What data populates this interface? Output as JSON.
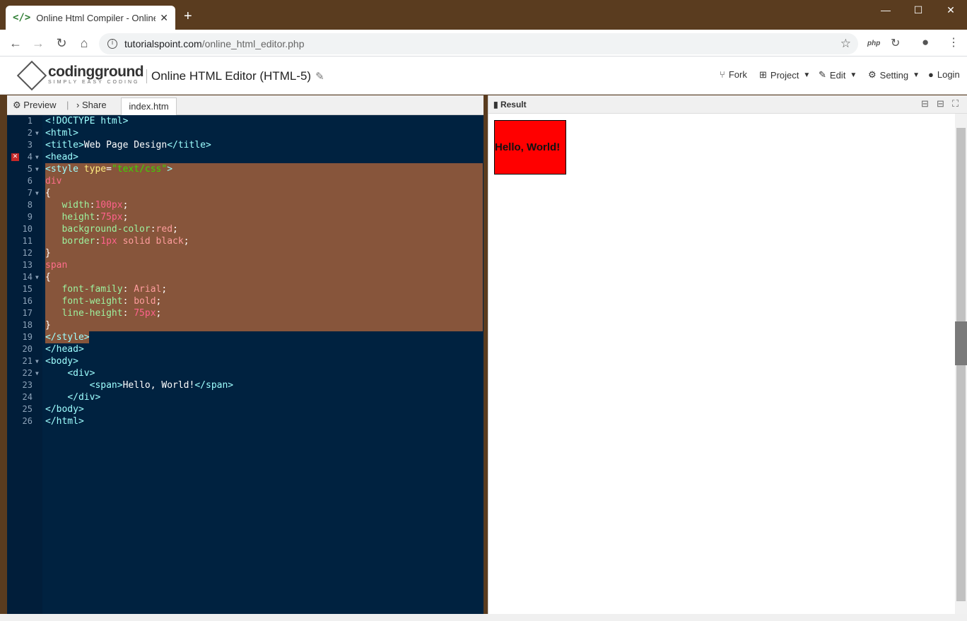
{
  "browser": {
    "tab_title": "Online Html Compiler - Online H",
    "tab_icon": "</>",
    "url_host": "tutorialspoint.com",
    "url_path": "/online_html_editor.php",
    "ext_php": "php"
  },
  "app": {
    "logo_name": "codingground",
    "logo_tagline": "SIMPLY EASY CODING",
    "title": "Online HTML Editor (HTML-5)",
    "menu": {
      "fork": "Fork",
      "project": "Project",
      "edit": "Edit",
      "setting": "Setting",
      "login": "Login"
    }
  },
  "editor": {
    "preview": "Preview",
    "share": "Share",
    "file_tab": "index.htm",
    "line_numbers": [
      "1",
      "2",
      "3",
      "4",
      "5",
      "6",
      "7",
      "8",
      "9",
      "10",
      "11",
      "12",
      "13",
      "14",
      "15",
      "16",
      "17",
      "18",
      "19",
      "20",
      "21",
      "22",
      "23",
      "24",
      "25",
      "26"
    ]
  },
  "result": {
    "label": "Result",
    "demo_text": "Hello, World!"
  },
  "colors": {
    "editor_bg": "#002240",
    "selection": "#87553b",
    "title_bar": "#5a3c1f"
  }
}
